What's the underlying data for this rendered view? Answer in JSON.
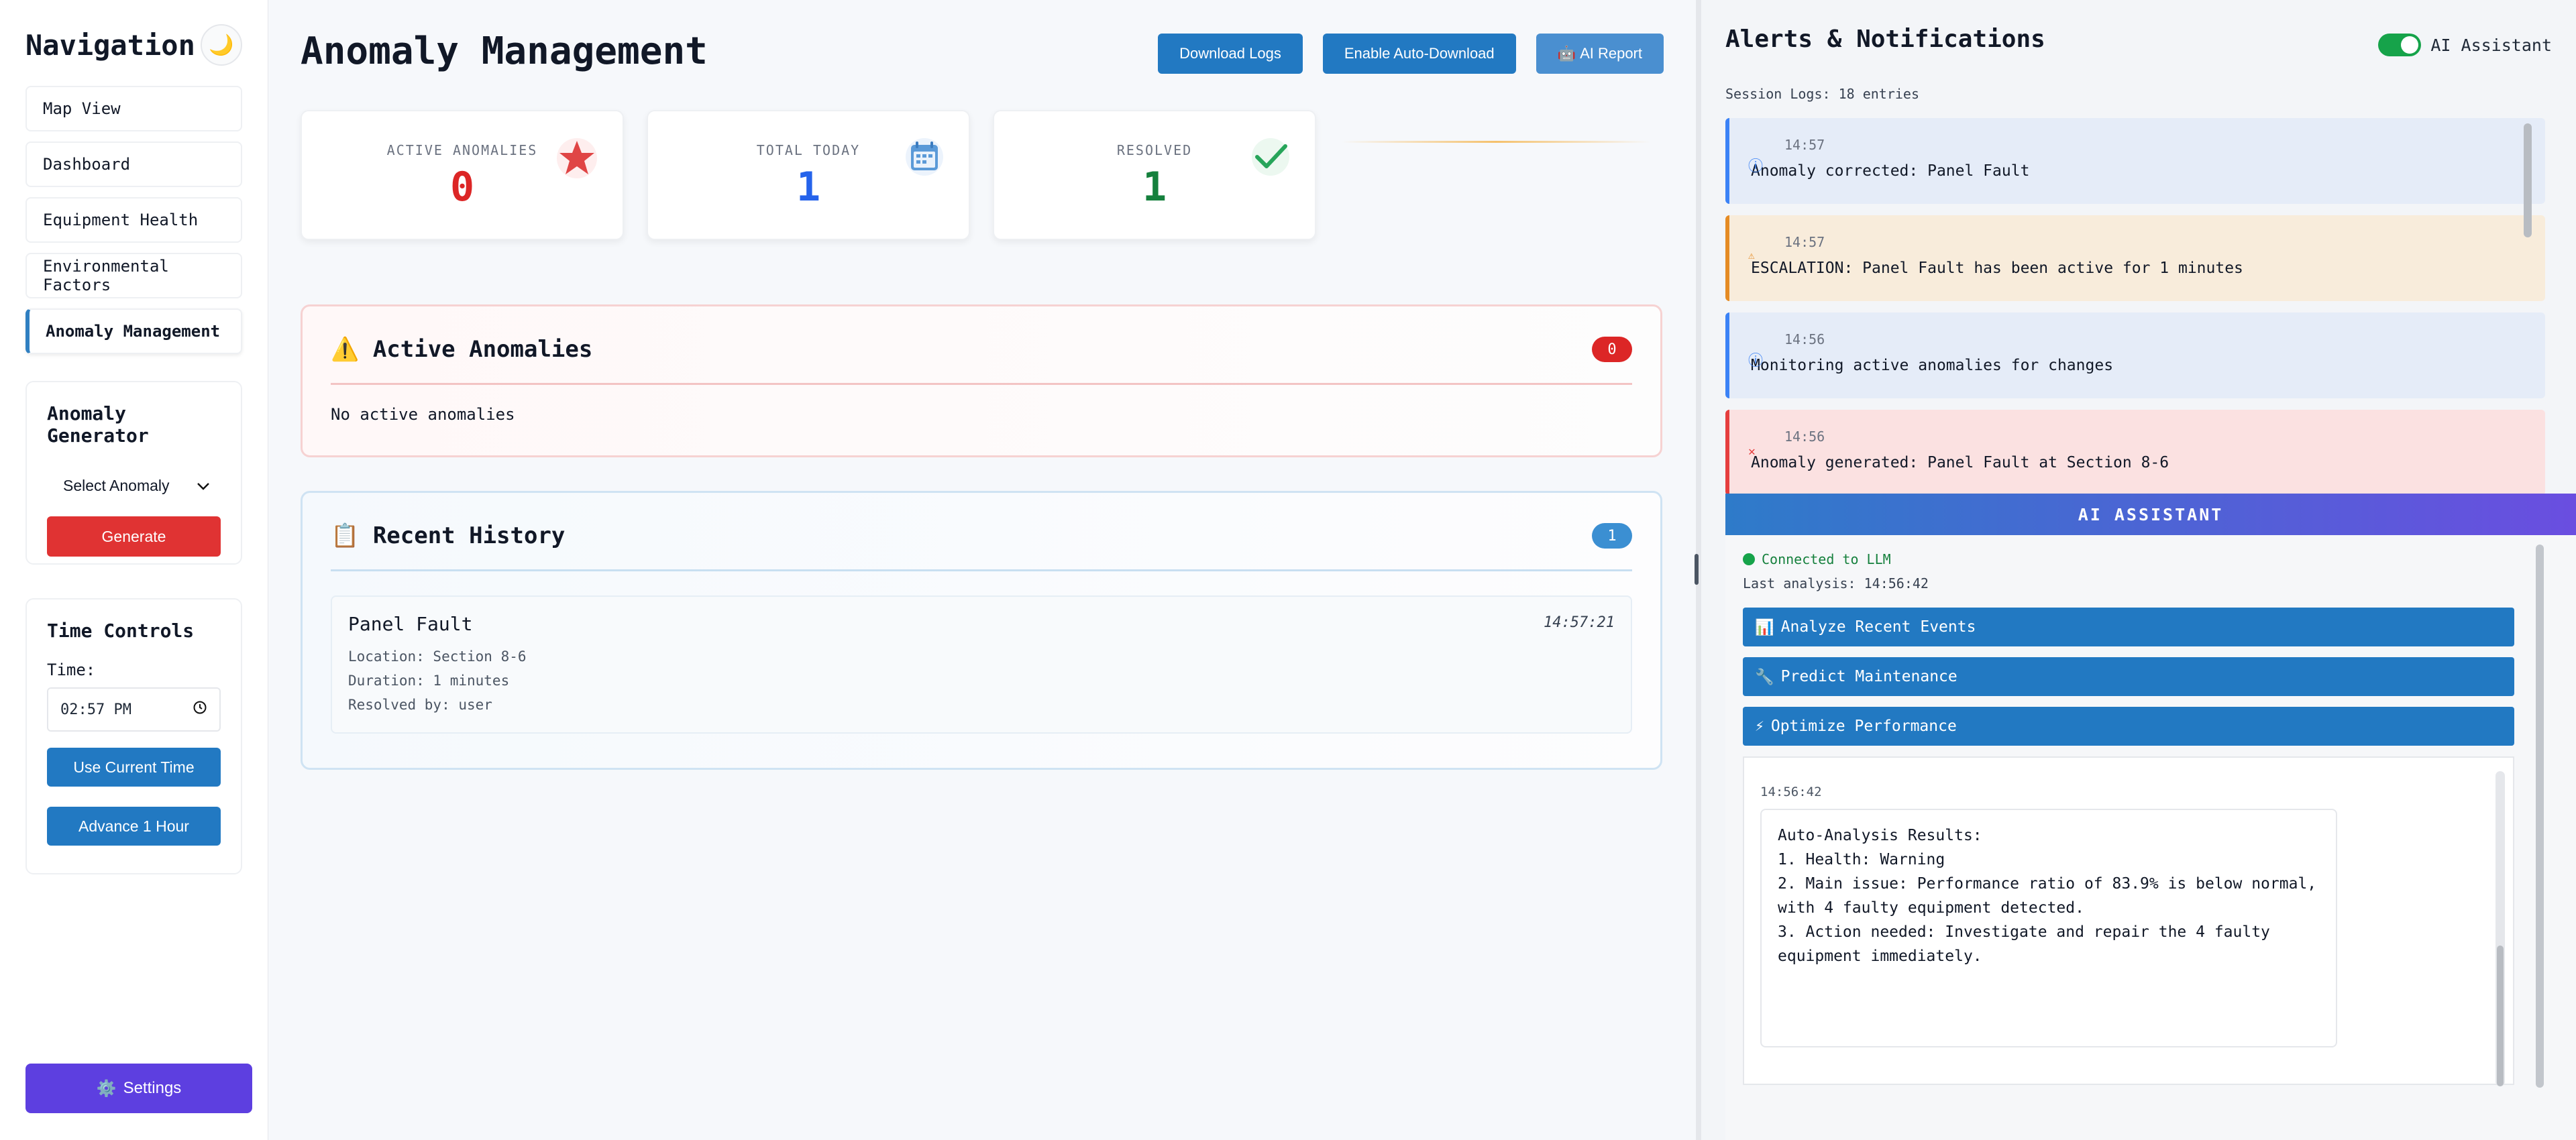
{
  "sidebar": {
    "title": "Navigation",
    "theme_icon": "moon-icon",
    "nav": [
      {
        "label": "Map View",
        "active": false
      },
      {
        "label": "Dashboard",
        "active": false
      },
      {
        "label": "Equipment Health",
        "active": false
      },
      {
        "label": "Environmental Factors",
        "active": false
      },
      {
        "label": "Anomaly Management",
        "active": true
      }
    ],
    "generator": {
      "title": "Anomaly Generator",
      "select_value": "Select Anomaly",
      "generate_label": "Generate"
    },
    "time_controls": {
      "title": "Time Controls",
      "time_label": "Time:",
      "time_value": "02:57 PM",
      "use_current_label": "Use Current Time",
      "advance_label": "Advance 1 Hour"
    },
    "settings_label": "Settings"
  },
  "main": {
    "title": "Anomaly Management",
    "buttons": {
      "download_logs": "Download Logs",
      "enable_auto_download": "Enable Auto-Download",
      "ai_report": "AI Report"
    },
    "stats": [
      {
        "label": "ACTIVE ANOMALIES",
        "value": "0",
        "color": "#dc2626",
        "icon": "star-icon"
      },
      {
        "label": "TOTAL TODAY",
        "value": "1",
        "color": "#2563eb",
        "icon": "calendar-icon"
      },
      {
        "label": "RESOLVED",
        "value": "1",
        "color": "#15803d",
        "icon": "check-icon"
      }
    ],
    "active_card": {
      "title": "Active Anomalies",
      "count": "0",
      "empty_text": "No active anomalies"
    },
    "history_card": {
      "title": "Recent History",
      "count": "1",
      "items": [
        {
          "name": "Panel Fault",
          "time": "14:57:21",
          "location": "Location: Section 8-6",
          "duration": "Duration: 1 minutes",
          "resolved_by": "Resolved by: user"
        }
      ]
    }
  },
  "right": {
    "title": "Alerts & Notifications",
    "ai_toggle_label": "AI Assistant",
    "ai_toggle_on": true,
    "session_logs": "Session Logs: 18 entries",
    "logs": [
      {
        "type": "info",
        "time": "14:57",
        "message": "Anomaly corrected: Panel Fault"
      },
      {
        "type": "warn",
        "time": "14:57",
        "message": "ESCALATION: Panel Fault has been active for 1 minutes"
      },
      {
        "type": "info",
        "time": "14:56",
        "message": "Monitoring active anomalies for changes"
      },
      {
        "type": "error",
        "time": "14:56",
        "message": "Anomaly generated: Panel Fault at Section 8-6"
      }
    ],
    "ai": {
      "header": "AI ASSISTANT",
      "status": "Connected to LLM",
      "last_analysis": "Last analysis: 14:56:42",
      "actions": [
        "Analyze Recent Events",
        "Predict Maintenance",
        "Optimize Performance"
      ],
      "chat_time": "14:56:42",
      "chat_text": "Auto-Analysis Results:\n1. Health: Warning\n2. Main issue: Performance ratio of 83.9% is below normal,\nwith 4 faulty equipment detected.\n3. Action needed: Investigate and repair the 4 faulty\nequipment immediately."
    }
  }
}
